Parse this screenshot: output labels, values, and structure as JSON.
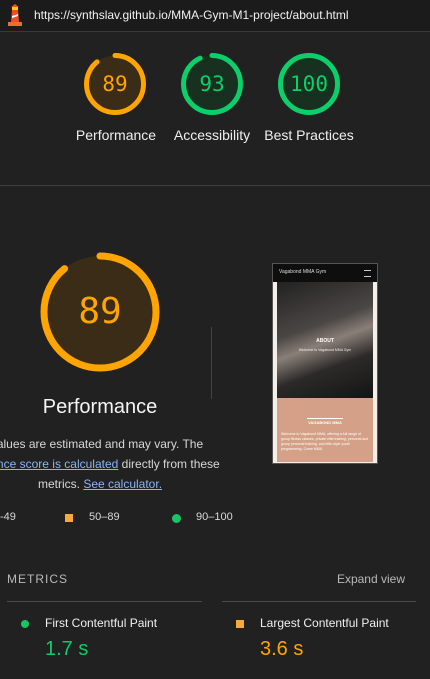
{
  "browser": {
    "url": "https://synthslav.github.io/MMA-Gym-M1-project/about.html"
  },
  "colors": {
    "good": "#0cce6b",
    "average": "#ffa400",
    "poor": "#ff4e42",
    "link": "#8ab4f8"
  },
  "top_scores": [
    {
      "score": "89",
      "label": "Performance",
      "status": "average"
    },
    {
      "score": "93",
      "label": "Accessibility",
      "status": "good"
    },
    {
      "score": "100",
      "label": "Best Practices",
      "status": "good"
    }
  ],
  "performance": {
    "score": "89",
    "title": "Performance",
    "desc_part1": "alues are estimated and may vary. The",
    "desc_link1": "mance score is calculated",
    "desc_part2": " directly from these",
    "desc_part3": "metrics. ",
    "desc_link2": "See calculator."
  },
  "screenshot": {
    "brand": "Vagabond MMA Gym",
    "hero_title": "ABOUT",
    "hero_sub": "Welcome to Vagabond MMA Gym",
    "band_title": "VAGABOND MMA",
    "band_text": "Welcome to Vagabond MMA, offering a full range of group fitness classes, private elite training, personal and group personal training, and elite-style youth programming. Come MMA"
  },
  "legend": [
    {
      "range": "-49",
      "shape": "triangle"
    },
    {
      "range": "50–89",
      "shape": "square"
    },
    {
      "range": "90–100",
      "shape": "circle"
    }
  ],
  "metrics": {
    "header": "METRICS",
    "expand_label": "Expand view",
    "items": [
      {
        "name": "First Contentful Paint",
        "value": "1.7 s",
        "status": "good"
      },
      {
        "name": "Largest Contentful Paint",
        "value": "3.6 s",
        "status": "average"
      }
    ]
  }
}
